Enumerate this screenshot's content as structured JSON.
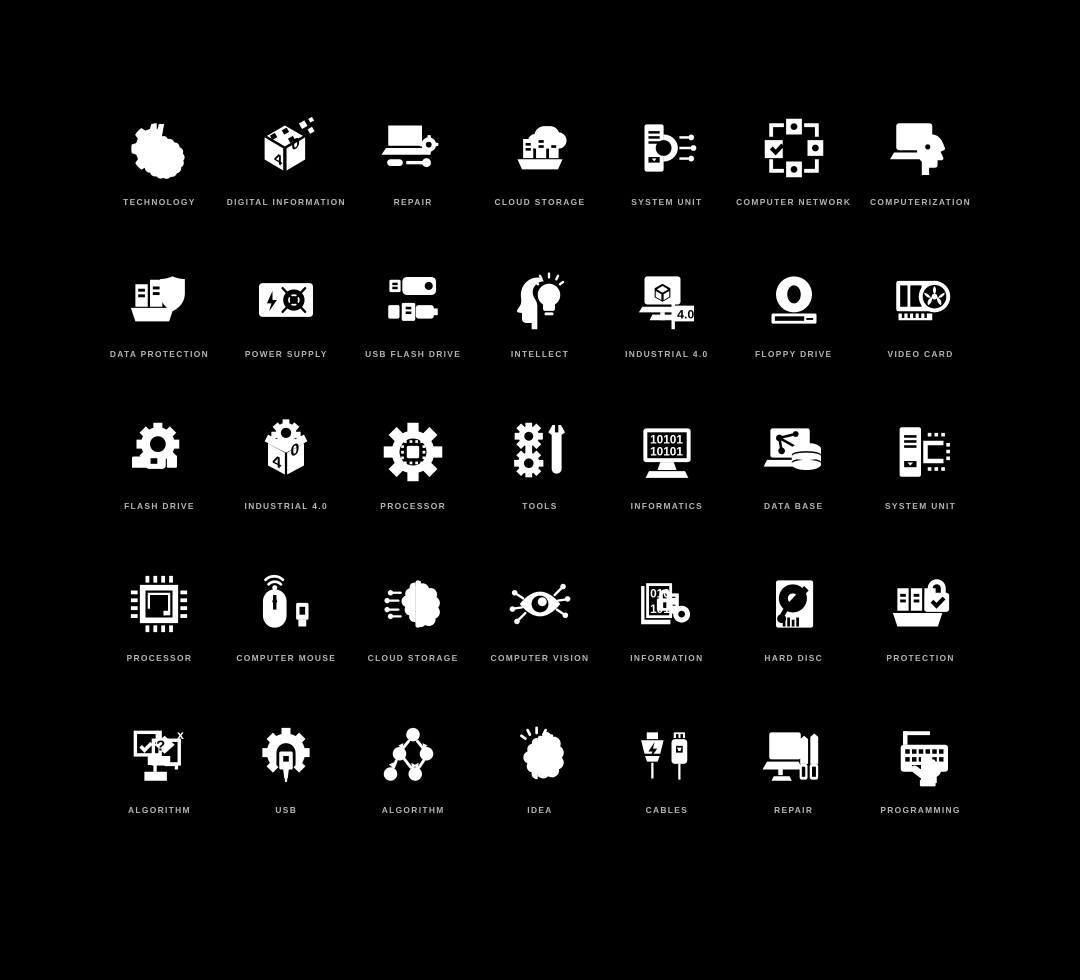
{
  "sheet": {
    "background_color": "#000000",
    "icon_color": "#ffffff",
    "label_color": "#b4b4b4",
    "columns": 7,
    "rows": 5,
    "total_icons": 35
  },
  "icons": [
    {
      "label": "TECHNOLOGY",
      "icon": "gear-brain-icon"
    },
    {
      "label": "DIGITAL INFORMATION",
      "icon": "cube-4-0-pixels-icon"
    },
    {
      "label": "REPAIR",
      "icon": "monitor-gear-tools-icon"
    },
    {
      "label": "CLOUD STORAGE",
      "icon": "cloud-servers-icon"
    },
    {
      "label": "SYSTEM UNIT",
      "icon": "tower-circuit-icon"
    },
    {
      "label": "COMPUTER NETWORK",
      "icon": "network-nodes-check-icon"
    },
    {
      "label": "COMPUTERIZATION",
      "icon": "monitor-head-icon"
    },
    {
      "label": "DATA PROTECTION",
      "icon": "servers-shield-icon"
    },
    {
      "label": "POWER SUPPLY",
      "icon": "psu-bolt-fan-icon"
    },
    {
      "label": "USB FLASH DRIVE",
      "icon": "two-usb-sticks-icon"
    },
    {
      "label": "INTELLECT",
      "icon": "head-lightbulb-icon"
    },
    {
      "label": "INDUSTRIAL 4.0",
      "icon": "monitor-cube-flag-40-icon"
    },
    {
      "label": "FLOPPY DRIVE",
      "icon": "disc-drive-icon"
    },
    {
      "label": "VIDEO CARD",
      "icon": "gpu-fan-icon"
    },
    {
      "label": "FLASH DRIVE",
      "icon": "gear-usb-plug-icon"
    },
    {
      "label": "INDUSTRIAL 4.0",
      "icon": "open-box-gear-40-icon"
    },
    {
      "label": "PROCESSOR",
      "icon": "gear-chip-icon"
    },
    {
      "label": "TOOLS",
      "icon": "gears-wrench-icon"
    },
    {
      "label": "INFORMATICS",
      "icon": "monitor-binary-10101-icon"
    },
    {
      "label": "DATA BASE",
      "icon": "monitor-database-icon"
    },
    {
      "label": "SYSTEM UNIT",
      "icon": "tower-chip-icon"
    },
    {
      "label": "PROCESSOR",
      "icon": "cpu-chip-icon"
    },
    {
      "label": "COMPUTER MOUSE",
      "icon": "mouse-wireless-dongle-icon"
    },
    {
      "label": "CLOUD STORAGE",
      "icon": "brain-circuit-cloud-icon"
    },
    {
      "label": "COMPUTER VISION",
      "icon": "eye-circuit-icon"
    },
    {
      "label": "INFORMATION",
      "icon": "documents-lock-key-icon"
    },
    {
      "label": "HARD DISC",
      "icon": "hard-disk-platter-icon"
    },
    {
      "label": "PROTECTION",
      "icon": "servers-padlock-check-icon"
    },
    {
      "label": "ALGORITHM",
      "icon": "flowchart-decision-icon"
    },
    {
      "label": "USB",
      "icon": "gear-usb-connector-icon"
    },
    {
      "label": "ALGORITHM",
      "icon": "node-graph-arrows-icon"
    },
    {
      "label": "IDEA",
      "icon": "brain-idea-rays-icon"
    },
    {
      "label": "CABLES",
      "icon": "power-usb-cables-icon"
    },
    {
      "label": "REPAIR",
      "icon": "monitor-screwdrivers-icon"
    },
    {
      "label": "PROGRAMMING",
      "icon": "keyboard-hand-typing-icon"
    }
  ],
  "icon_details": {
    "cube_faces_text": [
      "4",
      "0"
    ],
    "industrial_flag_text": "4.0",
    "informatics_screen_text": [
      "10101",
      "10101"
    ],
    "information_doc_text": [
      "010",
      "101"
    ],
    "algorithm_symbols": [
      "?",
      "x",
      "✓"
    ],
    "network_check_symbol": "✓",
    "protection_check_symbol": "✓"
  }
}
